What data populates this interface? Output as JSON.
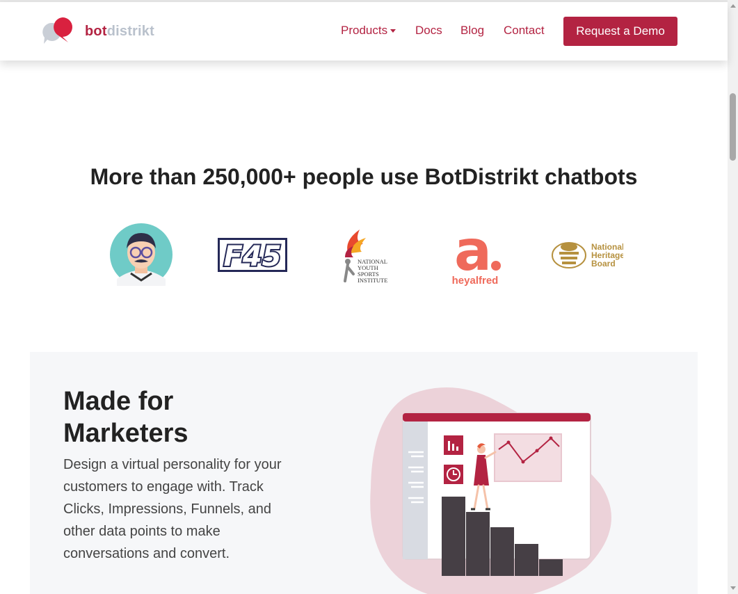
{
  "brand": {
    "logo_text_bold": "bot",
    "logo_text_light": "distrikt",
    "color_primary": "#b32342"
  },
  "nav": {
    "items": [
      {
        "label": "Products",
        "dropdown": true
      },
      {
        "label": "Docs"
      },
      {
        "label": "Blog"
      },
      {
        "label": "Contact"
      }
    ],
    "cta_label": "Request a Demo"
  },
  "hero": {
    "headline": "More than 250,000+ people use BotDistrikt chatbots"
  },
  "clients": [
    {
      "name": "avatar-mascot"
    },
    {
      "name": "F45",
      "text": "F45"
    },
    {
      "name": "National Youth Sports Institute",
      "lines": [
        "NATIONAL",
        "YOUTH",
        "SPORTS",
        "INSTITUTE"
      ]
    },
    {
      "name": "heyalfred",
      "text": "heyalfred",
      "mark": "a."
    },
    {
      "name": "National Heritage Board",
      "lines": [
        "National",
        "Heritage",
        "Board"
      ]
    }
  ],
  "feature": {
    "title": "Made for Marketers",
    "description": "Design a virtual personality for your customers to engage with. Track Clicks, Impressions, Funnels, and other data points to make conversations and convert."
  }
}
